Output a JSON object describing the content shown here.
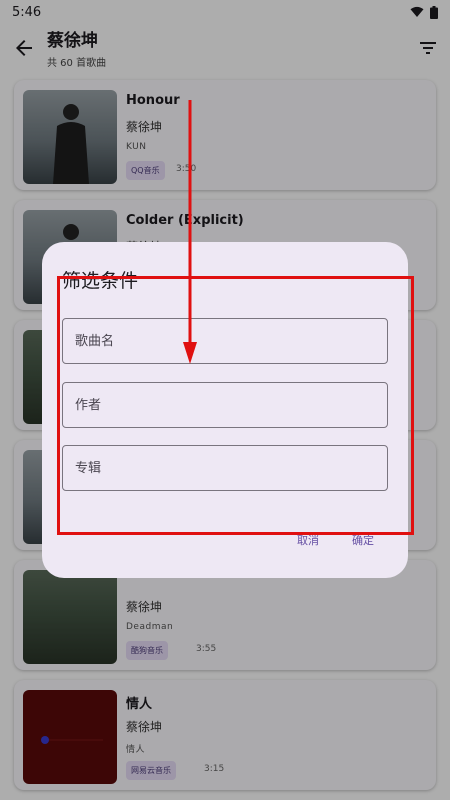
{
  "status": {
    "time": "5:46"
  },
  "header": {
    "title": "蔡徐坤",
    "subtitle": "共 60 首歌曲"
  },
  "songs": [
    {
      "title": "Honour",
      "artist": "蔡徐坤",
      "album": "KUN",
      "source": "QQ音乐",
      "duration": "3:50"
    },
    {
      "title": "Colder (Explicit)",
      "artist": "蔡徐坤",
      "album": "",
      "source": "",
      "duration": ""
    },
    {
      "title": "",
      "artist": "",
      "album": "",
      "source": "",
      "duration": ""
    },
    {
      "title": "",
      "artist": "",
      "album": "",
      "source": "",
      "duration": ""
    },
    {
      "title": "",
      "artist": "蔡徐坤",
      "album": "Deadman",
      "source": "酷狗音乐",
      "duration": "3:55"
    },
    {
      "title": "情人",
      "artist": "蔡徐坤",
      "album": "情人",
      "source": "网易云音乐",
      "duration": "3:15"
    }
  ],
  "dialog": {
    "title": "筛选条件",
    "fields": {
      "song_name": "歌曲名",
      "author": "作者",
      "album": "专辑"
    },
    "cancel": "取消",
    "confirm": "确定"
  },
  "colors": {
    "accent": "#6650a4",
    "annotation": "#e01010",
    "dialog_bg": "#eee8f4"
  },
  "icons": {
    "back": "arrow-left-icon",
    "filter": "filter-list-icon",
    "wifi": "wifi-icon",
    "battery": "battery-icon"
  }
}
